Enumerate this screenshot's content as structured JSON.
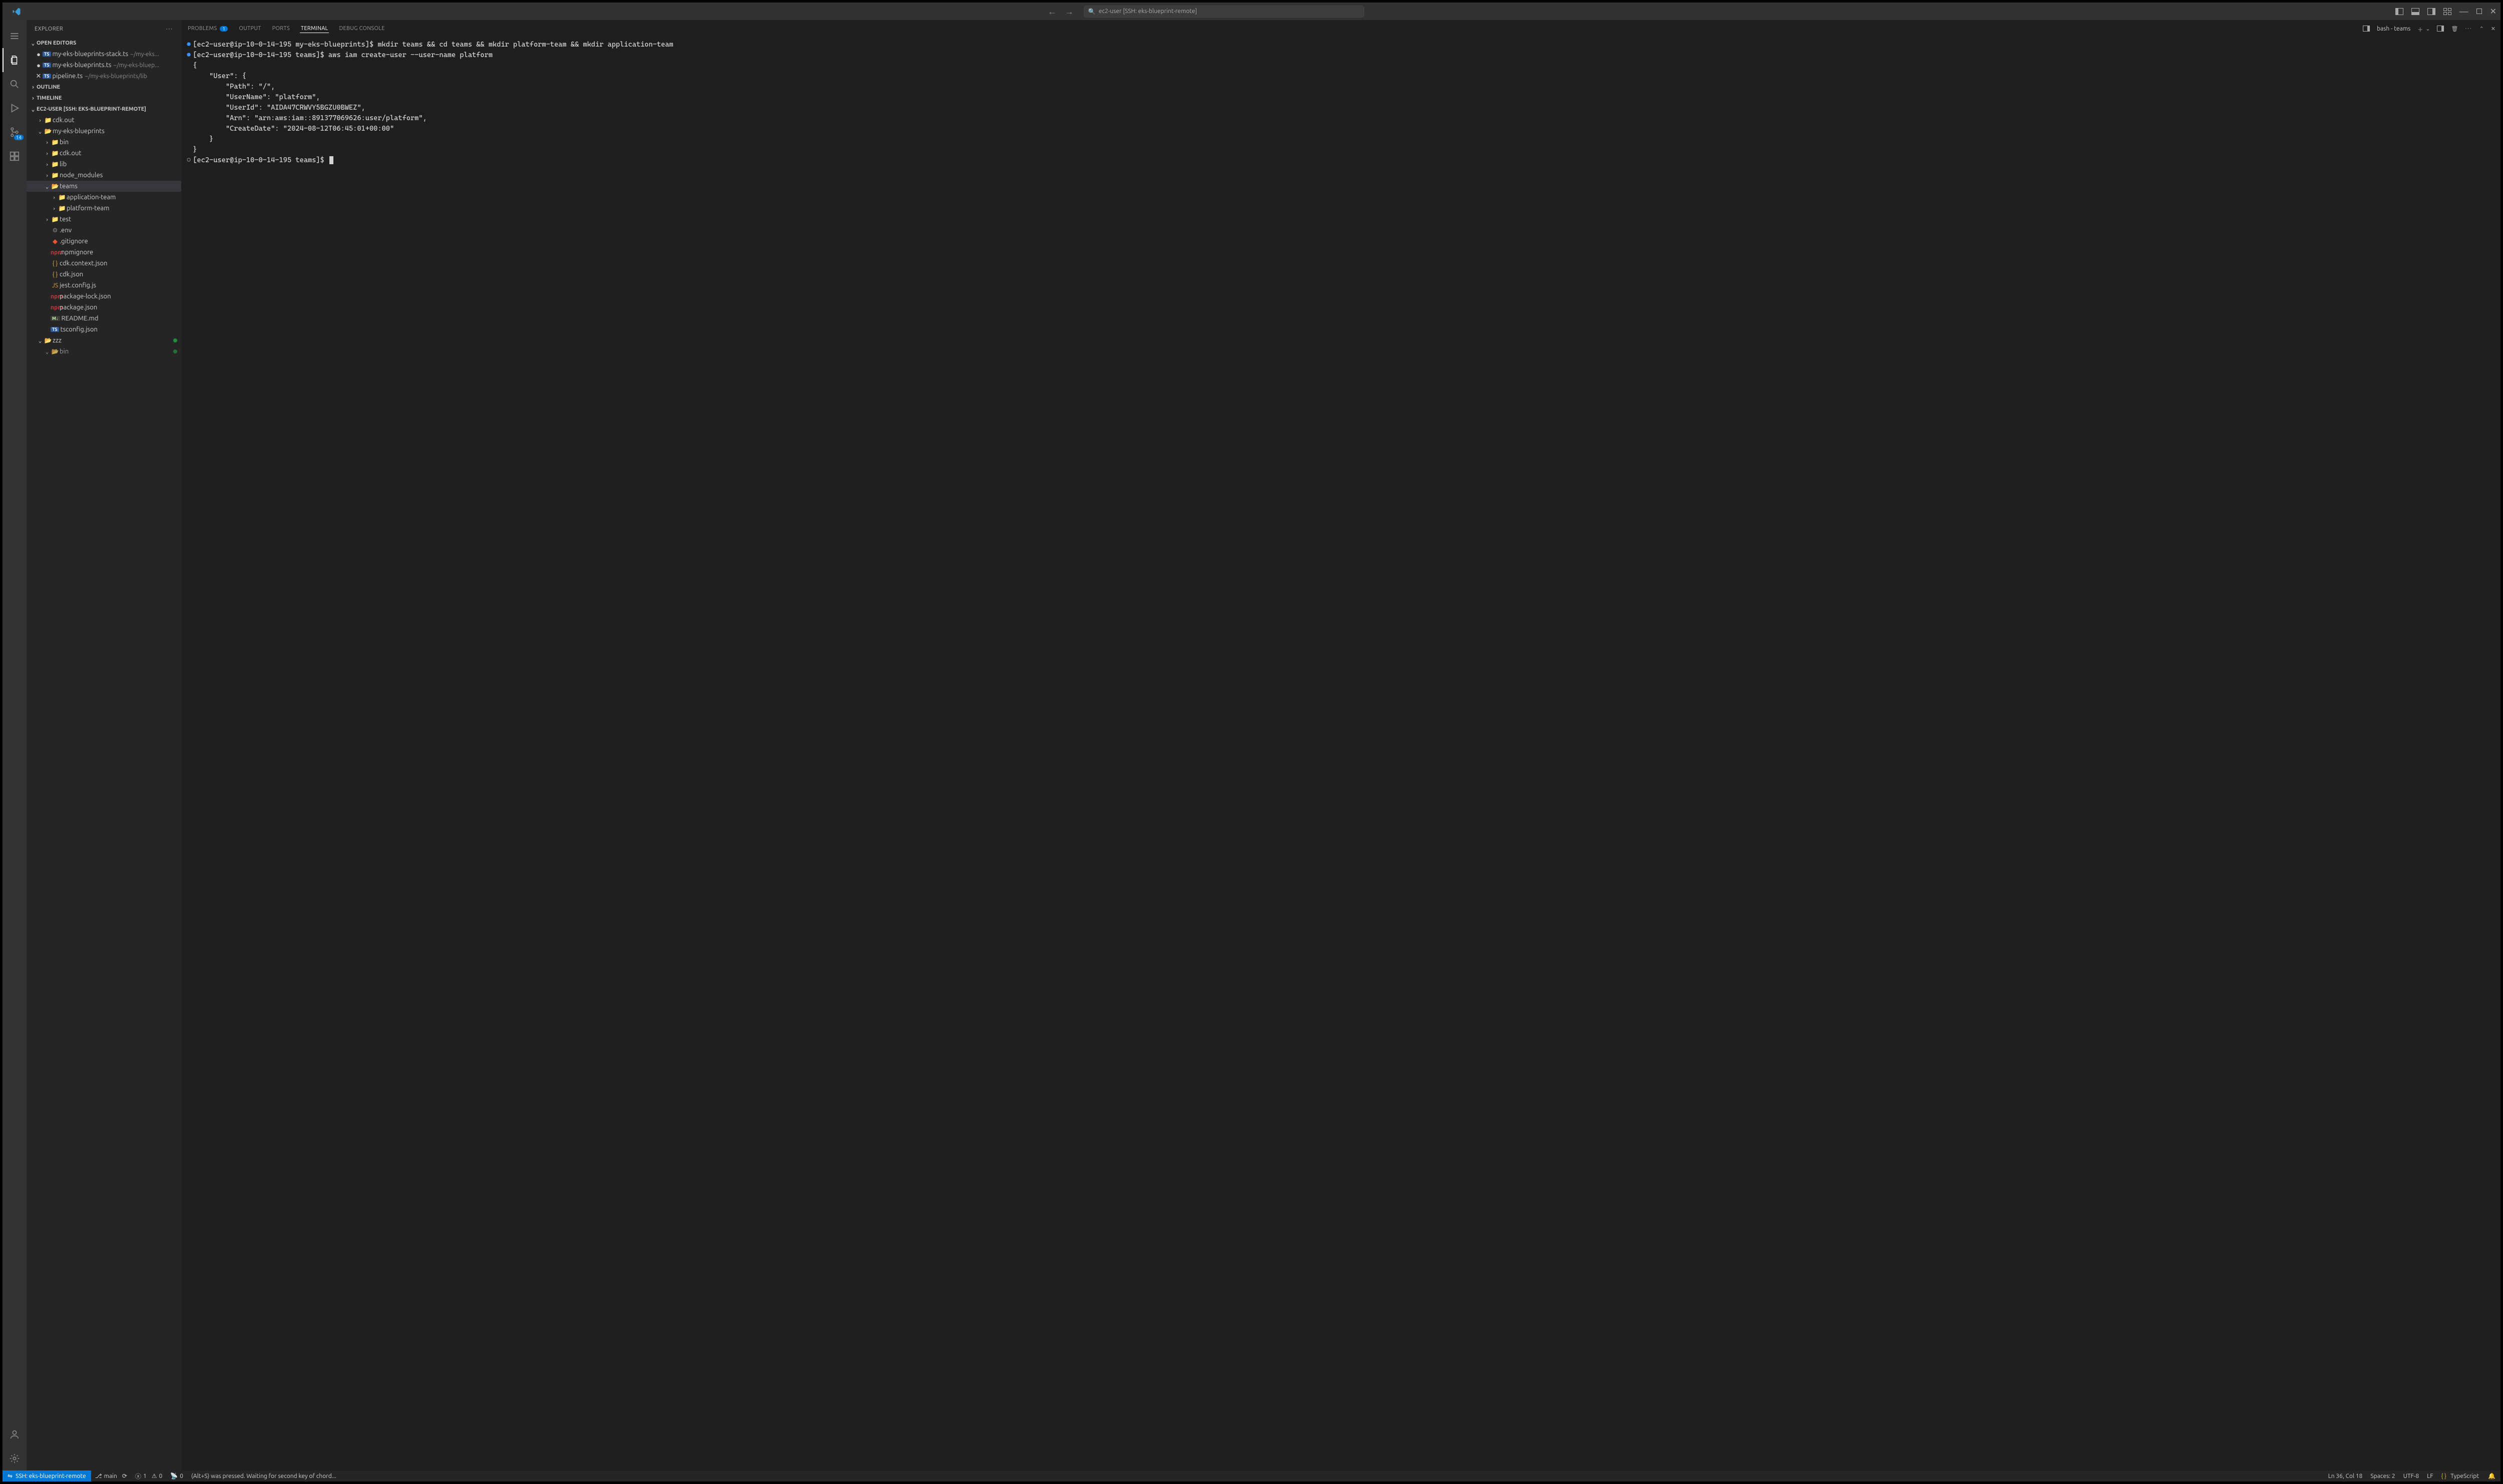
{
  "titlebar": {
    "search_placeholder": "ec2-user [SSH: eks-blueprint-remote]"
  },
  "activitybar": {
    "scm_badge": "14"
  },
  "sidebar": {
    "title": "EXPLORER",
    "open_editors": {
      "label": "OPEN EDITORS",
      "items": [
        {
          "icon": "TS",
          "name": "my-eks-blueprints-stack.ts",
          "path": "~/my-eks...",
          "modified": true
        },
        {
          "icon": "TS",
          "name": "my-eks-blueprints.ts",
          "path": "~/my-eks-bluep...",
          "modified": true
        },
        {
          "icon": "TS",
          "name": "pipeline.ts",
          "path": "~/my-eks-blueprints/lib",
          "modified": false,
          "active": true
        }
      ]
    },
    "outline_label": "OUTLINE",
    "timeline_label": "TIMELINE",
    "workspace": {
      "label": "EC2-USER [SSH: EKS-BLUEPRINT-REMOTE]",
      "tree": [
        {
          "depth": 1,
          "kind": "folder",
          "open": false,
          "name": "cdk.out"
        },
        {
          "depth": 1,
          "kind": "folder",
          "open": true,
          "name": "my-eks-blueprints"
        },
        {
          "depth": 2,
          "kind": "folder",
          "open": false,
          "name": "bin",
          "icon": "red"
        },
        {
          "depth": 2,
          "kind": "folder",
          "open": false,
          "name": "cdk.out"
        },
        {
          "depth": 2,
          "kind": "folder",
          "open": false,
          "name": "lib",
          "icon": "pink"
        },
        {
          "depth": 2,
          "kind": "folder",
          "open": false,
          "name": "node_modules",
          "icon": "green"
        },
        {
          "depth": 2,
          "kind": "folder",
          "open": true,
          "name": "teams",
          "selected": true
        },
        {
          "depth": 3,
          "kind": "folder",
          "open": false,
          "name": "application-team"
        },
        {
          "depth": 3,
          "kind": "folder",
          "open": false,
          "name": "platform-team"
        },
        {
          "depth": 2,
          "kind": "folder",
          "open": false,
          "name": "test",
          "icon": "red"
        },
        {
          "depth": 2,
          "kind": "file",
          "name": ".env",
          "icon": "gear"
        },
        {
          "depth": 2,
          "kind": "file",
          "name": ".gitignore",
          "icon": "git"
        },
        {
          "depth": 2,
          "kind": "file",
          "name": ".npmignore",
          "icon": "npm"
        },
        {
          "depth": 2,
          "kind": "file",
          "name": "cdk.context.json",
          "icon": "json"
        },
        {
          "depth": 2,
          "kind": "file",
          "name": "cdk.json",
          "icon": "json"
        },
        {
          "depth": 2,
          "kind": "file",
          "name": "jest.config.js",
          "icon": "js"
        },
        {
          "depth": 2,
          "kind": "file",
          "name": "package-lock.json",
          "icon": "npm"
        },
        {
          "depth": 2,
          "kind": "file",
          "name": "package.json",
          "icon": "npm"
        },
        {
          "depth": 2,
          "kind": "file",
          "name": "README.md",
          "icon": "md"
        },
        {
          "depth": 2,
          "kind": "file",
          "name": "tsconfig.json",
          "icon": "ts"
        },
        {
          "depth": 1,
          "kind": "folder",
          "open": true,
          "name": "zzz",
          "dot": true
        },
        {
          "depth": 2,
          "kind": "folder",
          "open": true,
          "name": "bin",
          "icon": "red",
          "dot": true,
          "cutoff": true
        }
      ]
    }
  },
  "panel": {
    "tabs": {
      "problems": "PROBLEMS",
      "problems_badge": "1",
      "output": "OUTPUT",
      "ports": "PORTS",
      "terminal": "TERMINAL",
      "debug_console": "DEBUG CONSOLE"
    },
    "terminal_label": "bash - teams",
    "lines": [
      {
        "marker": "filled",
        "text": "[ec2-user@ip-10-0-14-195 my-eks-blueprints]$ mkdir teams && cd teams && mkdir platform-team && mkdir application-team"
      },
      {
        "marker": "filled",
        "text": "[ec2-user@ip-10-0-14-195 teams]$ aws iam create-user --user-name platform"
      },
      {
        "text": "{"
      },
      {
        "text": "    \"User\": {"
      },
      {
        "text": "        \"Path\": \"/\","
      },
      {
        "text": "        \"UserName\": \"platform\","
      },
      {
        "text": "        \"UserId\": \"AIDA47CRWVY5BGZU0BWEZ\","
      },
      {
        "text": "        \"Arn\": \"arn:aws:iam::891377069626:user/platform\","
      },
      {
        "text": "        \"CreateDate\": \"2024-08-12T06:45:01+00:00\""
      },
      {
        "text": "    }"
      },
      {
        "text": "}"
      },
      {
        "marker": "hollow",
        "text": "[ec2-user@ip-10-0-14-195 teams]$ ",
        "cursor": true
      }
    ]
  },
  "statusbar": {
    "remote": "SSH: eks-blueprint-remote",
    "branch": "main",
    "errors": "1",
    "warnings": "0",
    "ports": "0",
    "message": "(Alt+S) was pressed. Waiting for second key of chord...",
    "cursor": "Ln 36, Col 18",
    "spaces": "Spaces: 2",
    "encoding": "UTF-8",
    "eol": "LF",
    "lang": "TypeScript"
  }
}
